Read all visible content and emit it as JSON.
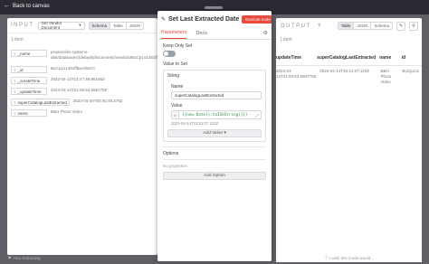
{
  "topbar": {
    "back_label": "Back to canvas"
  },
  "input": {
    "title": "INPUT",
    "node_select": "Get Vendor Document",
    "tabs": [
      "Schema",
      "Table",
      "JSON"
    ],
    "active_tab": "Schema",
    "item_count": "1 item",
    "fields": [
      {
        "name": "_name",
        "value": "projects/do-systems-ab5/databases/(default)/documents/vendors/BuCp1o1481ffbwviWcIzi"
      },
      {
        "name": "_id",
        "value": "BuCp1o1481ffbwviWcIzi"
      },
      {
        "name": "_createTime",
        "value": "2023-04-14T21:47:48.95166Z"
      },
      {
        "name": "_updateTime",
        "value": "2023-04-14T21:55:53.566770Z"
      },
      {
        "name": "superCatalogLastExtracted",
        "value": "2023-04-20T00:40:48.376Z"
      },
      {
        "name": "name",
        "value": "B&H Photo Video"
      }
    ],
    "footer": "Also Extracting"
  },
  "modal": {
    "title": "Set Last Extracted Date",
    "execute_label": "Execute node",
    "tabs": [
      "Parameters",
      "Docs"
    ],
    "active_tab": "Parameters",
    "keep_only_set_label": "Keep Only Set",
    "value_to_set_label": "Value to Set",
    "string_label": "String",
    "name_label": "Name",
    "name_value": "superCatalogLastExtracted",
    "value_label": "Value",
    "expression": "{{new Date().toISOString()}}",
    "expression_result": "2023-04-14T22:21:07.123Z",
    "add_value_label": "Add Value",
    "options_label": "Options",
    "no_properties": "No properties",
    "add_option_label": "Add Option"
  },
  "output": {
    "title": "OUTPUT",
    "item_count": "1 item",
    "tabs": [
      "Table",
      "JSON",
      "Schema"
    ],
    "active_tab": "Table",
    "columns": [
      "updateTime",
      "superCatalogLastExtracted",
      "name",
      "id"
    ],
    "row": [
      "2023-04-14T21:55:53.566770Z",
      "2023-04-14T22:21:07.123Z",
      "B&H Photo Video",
      "BuCp1o1"
    ],
    "footer": "I wish this mode would..."
  }
}
